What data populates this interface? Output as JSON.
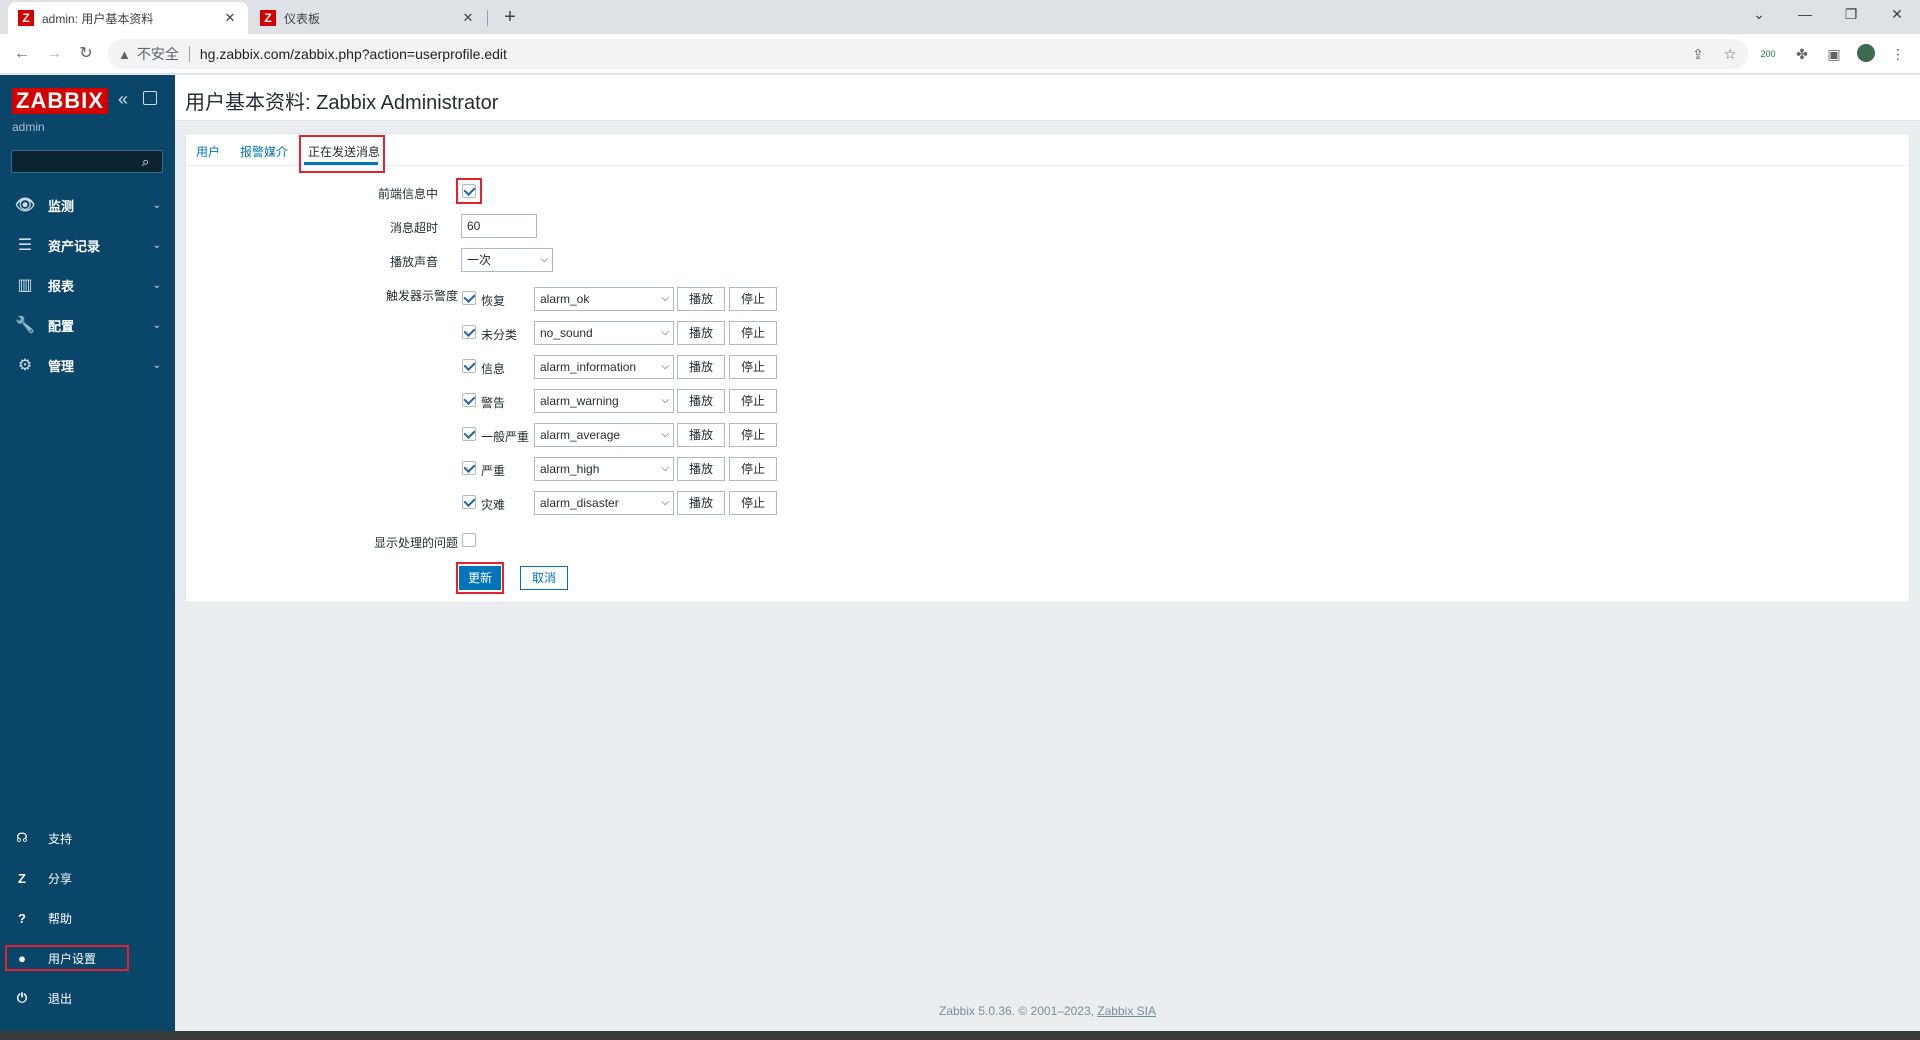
{
  "browser": {
    "tabs": [
      {
        "title": "admin: 用户基本资料",
        "favicon": "Z"
      },
      {
        "title": "仪表板",
        "favicon": "Z"
      }
    ],
    "security_label": "不安全",
    "url": "hg.zabbix.com/zabbix.php?action=userprofile.edit",
    "ext_badge": "200"
  },
  "sidebar": {
    "logo": "ZABBIX",
    "user": "admin",
    "menu": [
      {
        "label": "监测",
        "icon": "eye-icon"
      },
      {
        "label": "资产记录",
        "icon": "list-icon"
      },
      {
        "label": "报表",
        "icon": "bar-chart-icon"
      },
      {
        "label": "配置",
        "icon": "wrench-icon"
      },
      {
        "label": "管理",
        "icon": "gear-icon"
      }
    ],
    "bottom": [
      {
        "label": "支持",
        "icon": "headset-icon"
      },
      {
        "label": "分享",
        "icon": "zabbix-share-icon"
      },
      {
        "label": "帮助",
        "icon": "help-icon"
      },
      {
        "label": "用户设置",
        "icon": "user-icon"
      },
      {
        "label": "退出",
        "icon": "power-icon"
      }
    ]
  },
  "page": {
    "title": "用户基本资料: Zabbix Administrator"
  },
  "form": {
    "tabs": [
      "用户",
      "报警媒介",
      "正在发送消息"
    ],
    "active_tab": "正在发送消息",
    "frontend_messaging": {
      "label": "前端信息中",
      "checked": true
    },
    "message_timeout": {
      "label": "消息超时",
      "value": "60"
    },
    "play_sound": {
      "label": "播放声音",
      "value": "一次"
    },
    "trigger_severity_label": "触发器示警度",
    "severities": [
      {
        "name": "恢复",
        "checked": true,
        "sound": "alarm_ok"
      },
      {
        "name": "未分类",
        "checked": true,
        "sound": "no_sound"
      },
      {
        "name": "信息",
        "checked": true,
        "sound": "alarm_information"
      },
      {
        "name": "警告",
        "checked": true,
        "sound": "alarm_warning"
      },
      {
        "name": "一般严重",
        "checked": true,
        "sound": "alarm_average"
      },
      {
        "name": "严重",
        "checked": true,
        "sound": "alarm_high"
      },
      {
        "name": "灾难",
        "checked": true,
        "sound": "alarm_disaster"
      }
    ],
    "play_label": "播放",
    "stop_label": "停止",
    "show_suppressed": {
      "label": "显示处理的问题",
      "checked": false
    },
    "update_label": "更新",
    "cancel_label": "取消"
  },
  "footer": {
    "text": "Zabbix 5.0.36. © 2001–2023, ",
    "link": "Zabbix SIA"
  }
}
